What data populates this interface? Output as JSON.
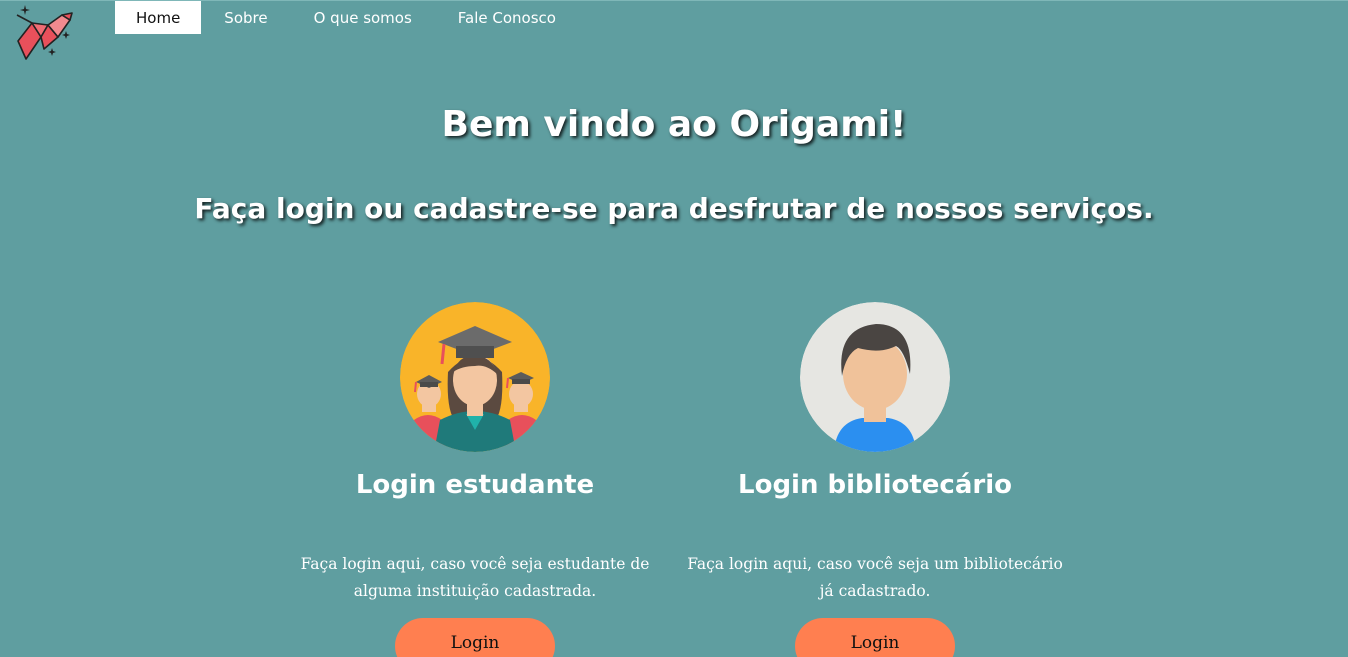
{
  "nav": {
    "items": [
      {
        "label": "Home",
        "active": true
      },
      {
        "label": "Sobre",
        "active": false
      },
      {
        "label": "O que somos",
        "active": false
      },
      {
        "label": "Fale Conosco",
        "active": false
      }
    ]
  },
  "hero": {
    "title": "Bem vindo ao Origami!",
    "subtitle": "Faça login ou cadastre-se para desfrutar de nossos serviços."
  },
  "cards": [
    {
      "title": "Login estudante",
      "description": "Faça login aqui, caso você seja estudante de alguma instituição cadastrada.",
      "button_label": "Login",
      "icon": "students-graduation-icon"
    },
    {
      "title": "Login bibliotecário",
      "description": "Faça login aqui, caso você seja um bibliotecário já cadastrado.",
      "button_label": "Login",
      "icon": "librarian-avatar-icon"
    }
  ],
  "colors": {
    "background": "#5f9ea0",
    "button": "#ff7f50",
    "nav_active_bg": "#ffffff"
  }
}
